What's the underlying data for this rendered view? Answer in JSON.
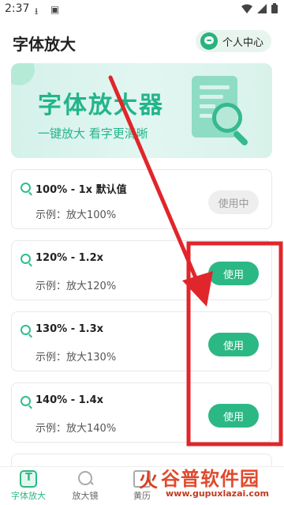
{
  "status_bar": {
    "time": "2:37",
    "icons": [
      "download-icon",
      "notification-icon",
      "wifi-icon",
      "signal-icon",
      "battery-icon"
    ]
  },
  "header": {
    "title": "字体放大",
    "profile_label": "个人中心"
  },
  "banner": {
    "title": "字体放大器",
    "subtitle": "一键放大  看字更清晰"
  },
  "options": [
    {
      "title": "100% - 1x 默认值",
      "example": "示例：放大100%",
      "button": "使用中",
      "state": "in-use"
    },
    {
      "title": "120% - 1.2x",
      "example": "示例：放大120%",
      "button": "使用",
      "state": "available"
    },
    {
      "title": "130% - 1.3x",
      "example": "示例：放大130%",
      "button": "使用",
      "state": "available"
    },
    {
      "title": "140% - 1.4x",
      "example": "示例：放大140%",
      "button": "使用",
      "state": "available"
    }
  ],
  "bottom_nav": [
    {
      "label": "字体放大",
      "icon": "text-icon",
      "active": true
    },
    {
      "label": "放大镜",
      "icon": "magnifier-icon",
      "active": false
    },
    {
      "label": "黄历",
      "icon": "calendar-icon",
      "active": false
    }
  ],
  "watermark": {
    "brand": "谷普软件园",
    "url": "www.gupuxlazai.com"
  },
  "colors": {
    "accent": "#2bb885",
    "annotation": "#e0262b"
  }
}
